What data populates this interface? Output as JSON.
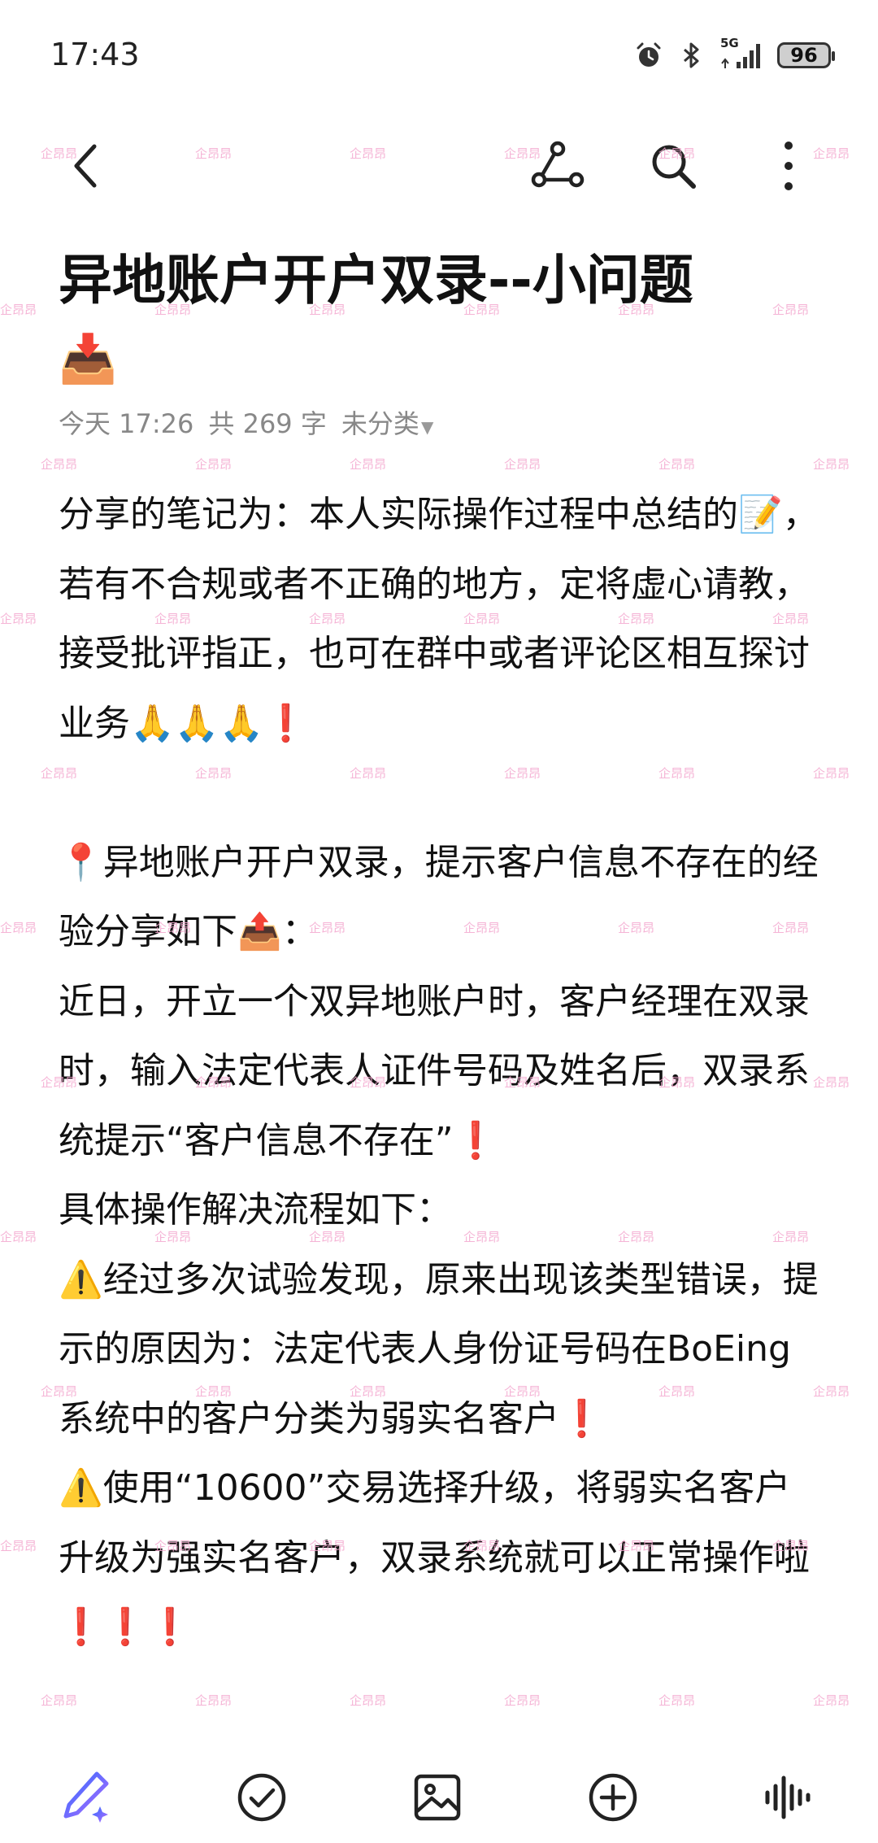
{
  "status_bar": {
    "time": "17:43",
    "network": "5G",
    "battery": "96"
  },
  "toolbar": {
    "back_icon": "chevron-left-icon",
    "share_icon": "share-nodes-icon",
    "search_icon": "search-icon",
    "more_icon": "more-vertical-icon"
  },
  "note": {
    "title": "异地账户开户双录--小问题",
    "title_emoji": "📥",
    "meta": {
      "date": "今天 17:26",
      "word_count": "共 269 字",
      "category": "未分类"
    },
    "paragraphs": [
      "分享的笔记为：本人实际操作过程中总结的📝，若有不合规或者不正确的地方，定将虚心请教，接受批评指正，也可在群中或者评论区相互探讨业务🙏🙏🙏❗",
      "",
      "📍异地账户开户双录，提示客户信息不存在的经验分享如下📤：",
      "近日，开立一个双异地账户时，客户经理在双录时，输入法定代表人证件号码及姓名后，双录系统提示“客户信息不存在”❗",
      "具体操作解决流程如下：",
      "⚠️经过多次试验发现，原来出现该类型错误，提示的原因为：法定代表人身份证号码在BoEing系统中的客户分类为弱实名客户❗",
      "⚠️使用“10600”交易选择升级，将弱实名客户升级为强实名客户，双录系统就可以正常操作啦❗❗❗"
    ]
  },
  "watermark": "企昂昂",
  "bottom_toolbar": {
    "ai_icon": "ai-pen-icon",
    "checklist_icon": "check-circle-icon",
    "image_icon": "image-icon",
    "add_icon": "plus-circle-icon",
    "voice_icon": "voice-wave-icon"
  },
  "colors": {
    "accent_gradient": [
      "#2f6bff",
      "#b36cff"
    ],
    "watermark": "#f4a8cf",
    "meta_text": "#888888"
  }
}
